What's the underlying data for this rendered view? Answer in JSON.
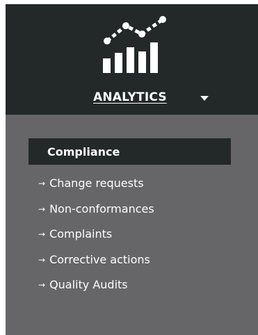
{
  "header": {
    "logo_icon": "analytics-chart-icon",
    "title": "ANALYTICS",
    "dropdown_icon": "caret-down-icon",
    "background": "#232828"
  },
  "section": {
    "title": "Compliance",
    "background": "#666568",
    "items": [
      {
        "arrow": "→",
        "label": "Change requests"
      },
      {
        "arrow": "→",
        "label": "Non-conformances"
      },
      {
        "arrow": "→",
        "label": "Complaints"
      },
      {
        "arrow": "→",
        "label": "Corrective actions"
      },
      {
        "arrow": "→",
        "label": "Quality Audits"
      }
    ]
  }
}
